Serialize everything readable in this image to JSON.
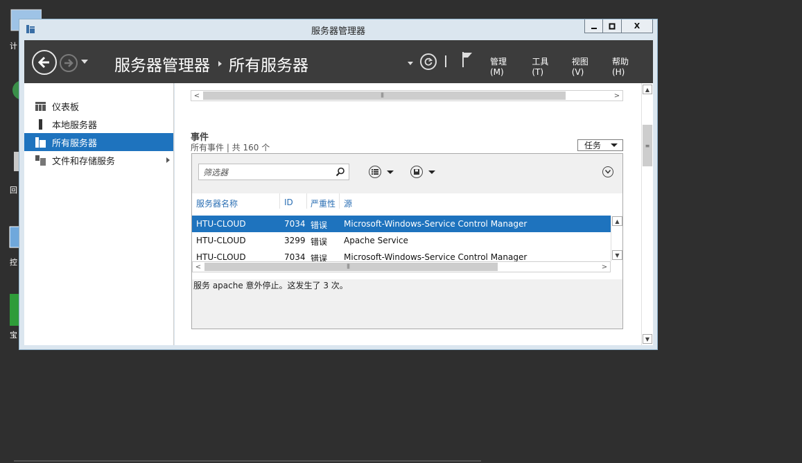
{
  "desktop": {
    "labels": [
      "计",
      "回",
      "控",
      "宝"
    ]
  },
  "window": {
    "title": "服务器管理器",
    "buttons": {
      "minimize": "▁",
      "maximize": "□",
      "close": "X"
    }
  },
  "header": {
    "breadcrumb": [
      "服务器管理器",
      "所有服务器"
    ],
    "menus": [
      "管理(M)",
      "工具(T)",
      "视图(V)",
      "帮助(H)"
    ]
  },
  "sidebar": {
    "items": [
      {
        "label": "仪表板",
        "icon": "dashboard-icon"
      },
      {
        "label": "本地服务器",
        "icon": "server-icon"
      },
      {
        "label": "所有服务器",
        "icon": "servers-icon",
        "active": true
      },
      {
        "label": "文件和存储服务",
        "icon": "storage-icon",
        "has_arrow": true
      }
    ]
  },
  "events": {
    "title": "事件",
    "subtitle": "所有事件 | 共 160 个",
    "tasks_label": "任务",
    "filter_placeholder": "筛选器",
    "columns": [
      "服务器名称",
      "ID",
      "严重性",
      "源"
    ],
    "rows": [
      {
        "server": "HTU-CLOUD",
        "id": "7034",
        "severity": "错误",
        "source": "Microsoft-Windows-Service Control Manager",
        "selected": true
      },
      {
        "server": "HTU-CLOUD",
        "id": "3299",
        "severity": "错误",
        "source": "Apache Service"
      },
      {
        "server": "HTU-CLOUD",
        "id": "7034",
        "severity": "错误",
        "source": "Microsoft-Windows-Service Control Manager"
      }
    ],
    "detail": "服务 apache 意外停止。这发生了 3 次。"
  },
  "colors": {
    "accent": "#1e73be",
    "header_bg": "#3c3c3c",
    "desktop_bg": "#2f2f2f"
  }
}
